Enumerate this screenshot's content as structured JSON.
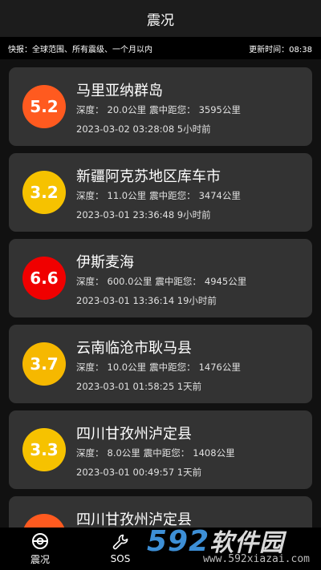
{
  "header": {
    "title": "震况"
  },
  "infobar": {
    "left": "快报：全球范围、所有震级、一个月以内",
    "right": "更新时间：08:38"
  },
  "labels": {
    "depth": "深度：",
    "distance": "震中距您："
  },
  "quakes": [
    {
      "mag": "5.2",
      "color": "#ff5a1f",
      "place": "马里亚纳群岛",
      "depth": "20.0公里",
      "distance": "3595公里",
      "time": "2023-03-02 03:28:08 5小时前"
    },
    {
      "mag": "3.2",
      "color": "#f6c200",
      "place": "新疆阿克苏地区库车市",
      "depth": "11.0公里",
      "distance": "3474公里",
      "time": "2023-03-01 23:36:48 9小时前"
    },
    {
      "mag": "6.6",
      "color": "#f00000",
      "place": "伊斯麦海",
      "depth": "600.0公里",
      "distance": "4945公里",
      "time": "2023-03-01 13:36:14 19小时前"
    },
    {
      "mag": "3.7",
      "color": "#f6b800",
      "place": "云南临沧市耿马县",
      "depth": "10.0公里",
      "distance": "1476公里",
      "time": "2023-03-01 01:58:25 1天前"
    },
    {
      "mag": "3.3",
      "color": "#f6c200",
      "place": "四川甘孜州泸定县",
      "depth": "8.0公里",
      "distance": "1408公里",
      "time": "2023-03-01 00:49:57 1天前"
    },
    {
      "mag": "",
      "color": "#ff5a1f",
      "place": "四川甘孜州泸定县",
      "depth": "",
      "distance": "",
      "time": ""
    }
  ],
  "tabs": [
    {
      "label": "震况",
      "icon": "earthquake-tab-icon"
    },
    {
      "label": "SOS",
      "icon": "wrench-icon"
    }
  ],
  "watermark": {
    "num": "592",
    "cn": "软件园",
    "url": "www.592xiazai.com"
  }
}
